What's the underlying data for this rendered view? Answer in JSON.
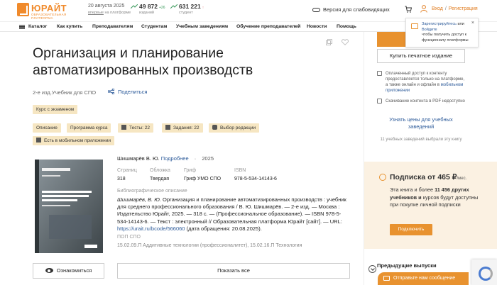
{
  "brand": {
    "name": "ЮРАЙТ",
    "tagline": "ОБРАЗОВАТЕЛЬНАЯ ПЛАТФОРМА"
  },
  "header": {
    "date": "20 августа 2025",
    "date_sub_prefix": "",
    "date_sub_link": "впервые",
    "date_sub_suffix": " на платформе",
    "stats": [
      {
        "value": "49 872",
        "delta": "+26",
        "label": "изданий"
      },
      {
        "value": "631 221",
        "delta": "↑",
        "label": "студент"
      }
    ],
    "vision_label": "Версия для слабовидящих",
    "login_label": "Вход",
    "register_label": "Регистрация"
  },
  "nav": {
    "items": [
      "Каталог",
      "Как купить",
      "Преподавателям",
      "Студентам",
      "Учебным заведениям",
      "Обучение преподавателей",
      "Новости",
      "Помощь"
    ]
  },
  "book": {
    "title": "Организация и планирование автоматизированных производств",
    "edition": "2-е изд.Учебник для СПО",
    "share_label": "Поделиться",
    "exam_tag": "Курс с экзаменом",
    "tags": [
      "Описание",
      "Программа курса",
      "Тесты: 22",
      "Задания: 22",
      "Выбор редакции",
      "Есть в мобильном приложении"
    ],
    "author": "Шишмарёв В. Ю.",
    "author_more": "Подробнее",
    "year": "2025",
    "fields": [
      {
        "label": "Страниц",
        "value": "318"
      },
      {
        "label": "Обложка",
        "value": "Твердая"
      },
      {
        "label": "Гриф",
        "value": "Гриф УМО СПО"
      },
      {
        "label": "ISBN",
        "value": "978-5-534-14143-6"
      }
    ],
    "bib_label": "Библиографическое описание",
    "bib_italic": "Шишмарёв, В. Ю.",
    "bib_text": " Организация и планирование автоматизированных производств : учебник для среднего профессионального образования / В. Ю. Шишмарёв. — 2-е изд. — Москва : Издательство Юрайт, 2025. — 318 с. — (Профессиональное образование). — ISBN 978-5-534-14143-6. — Текст : электронный // Образовательная платформа Юрайт [сайт]. — URL: ",
    "bib_url": "https://urait.ru/bcode/566060",
    "bib_end": " (дата обращения: 20.08.2025).",
    "pop_label": "ПОП СПО",
    "pop_value": "15.02.09.П Аддитивные технологии (профессионалитет), 15.02.16.П Технология",
    "preview_label": "Ознакомиться",
    "show_all_label": "Показать все"
  },
  "sidebar": {
    "buy_label": "Купить",
    "buy_print_label": "Купить печатное издание",
    "tooltip": {
      "link1": "Зарегистрируйтесь",
      "mid": " или ",
      "link2": "Войдите",
      "text": "чтобы получить доступ к функционалу платформы"
    },
    "feature1_text": "Оплаченный доступ к контенту предоставляется только на платформе, а также онлайн и офлайн в ",
    "feature1_link": "мобильном приложении",
    "feature2_text": "Скачивание контента в PDF недоступно",
    "price_link": "Узнать цены для учебных заведений",
    "chosen_text": "11 учебных заведений выбрали эту книгу",
    "subscription": {
      "title": "Подписка от 465 ₽",
      "per": "/мес.",
      "text_a": "Эта книга и более ",
      "text_bold": "11 456 других учебников и",
      "text_b": " курсов будут доступны при покупке личной подписки",
      "button": "Подключить"
    },
    "prev_label": "Предыдущие выпуски",
    "chat_label": "Отправьте нам сообщение"
  },
  "colors": {
    "accent": "#e8922f",
    "link": "#2d5b9a",
    "tag_bg": "#f6e6c2",
    "sub_bg": "#fbf1e2"
  }
}
